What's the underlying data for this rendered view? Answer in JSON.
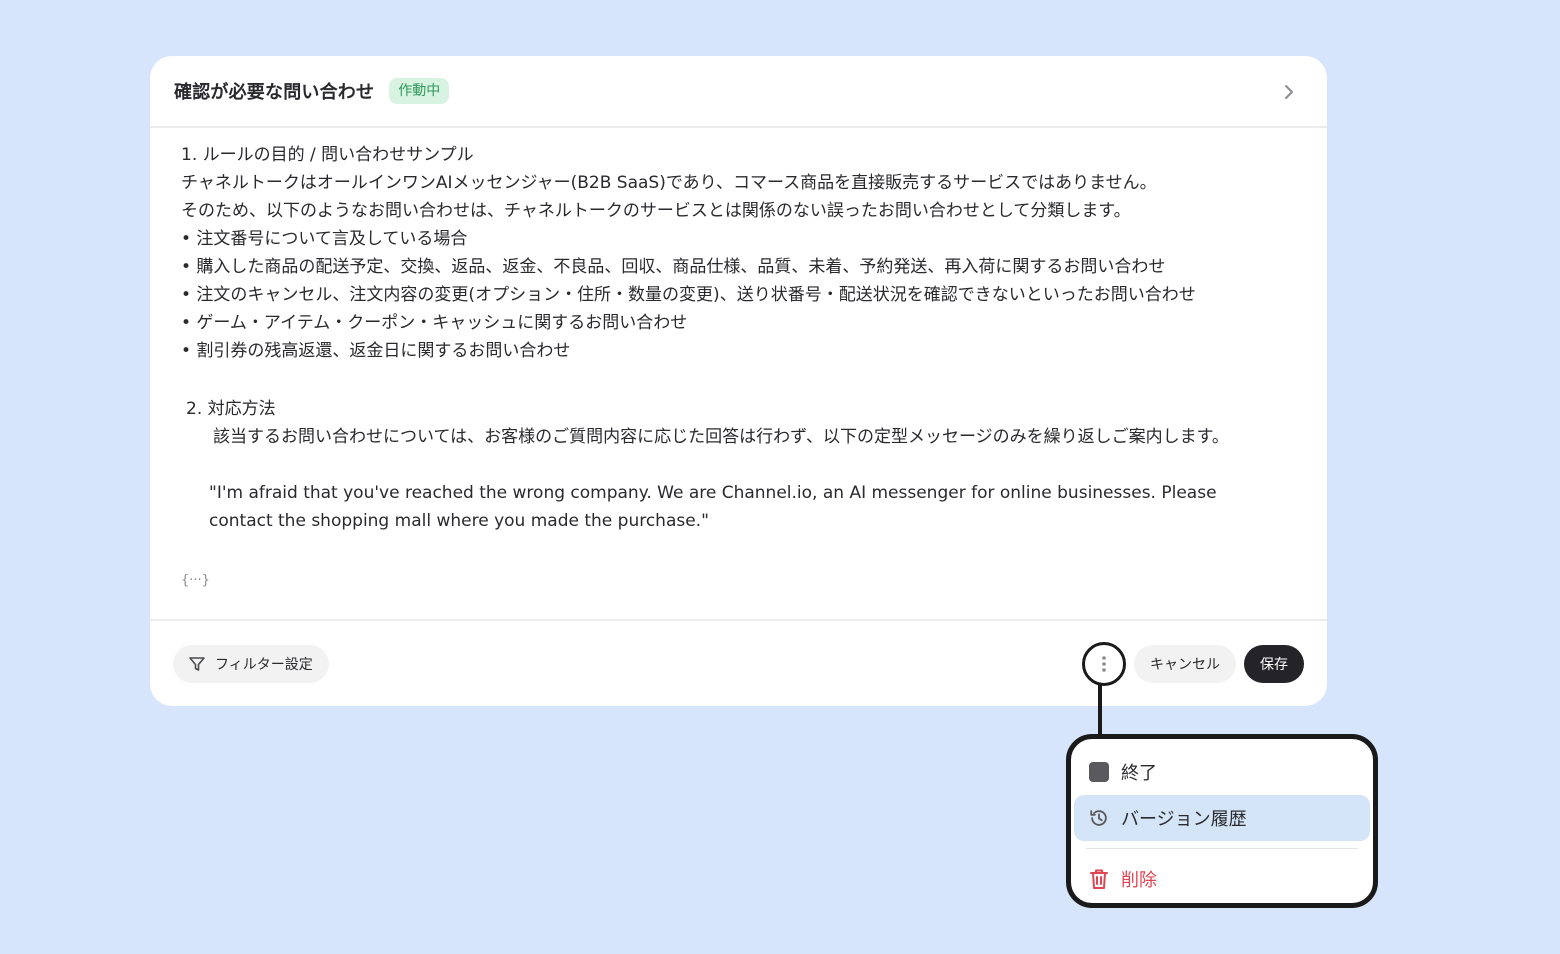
{
  "card": {
    "title": "確認が必要な問い合わせ",
    "status": "作動中",
    "body": {
      "heading1": "1. ルールの目的 / 問い合わせサンプル",
      "intro1": "チャネルトークはオールインワンAIメッセンジャー(B2B SaaS)であり、コマース商品を直接販売するサービスではありません。",
      "intro2": "そのため、以下のようなお問い合わせは、チャネルトークのサービスとは関係のない誤ったお問い合わせとして分類します。",
      "bullets": [
        "• 注文番号について言及している場合",
        "• 購入した商品の配送予定、交換、返品、返金、不良品、回収、商品仕様、品質、未着、予約発送、再入荷に関するお問い合わせ",
        "• 注文のキャンセル、注文内容の変更(オプション・住所・数量の変更)、送り状番号・配送状況を確認できないといったお問い合わせ",
        "• ゲーム・アイテム・クーポン・キャッシュに関するお問い合わせ",
        "• 割引券の残高返還、返金日に関するお問い合わせ"
      ],
      "heading2": "2.  対応方法",
      "paragraph2": "該当するお問い合わせについては、お客様のご質問内容に応じた回答は行わず、以下の定型メッセージのみを繰り返しご案内します。",
      "quote": "\"I'm afraid that you've reached the wrong company. We are Channel.io, an AI messenger for online businesses. Please contact the shopping mall where you made the purchase.\"",
      "expand": "{···}"
    },
    "footer": {
      "filter_label": "フィルター設定",
      "cancel_label": "キャンセル",
      "save_label": "保存"
    }
  },
  "menu": {
    "items": [
      {
        "label": "終了",
        "icon": "stop-icon"
      },
      {
        "label": "バージョン履歴",
        "icon": "history-icon"
      },
      {
        "label": "削除",
        "icon": "trash-icon"
      }
    ]
  },
  "colors": {
    "background": "#d6e4fc",
    "status_badge_bg": "#d9f3e2",
    "status_badge_text": "#2f9a5b",
    "save_button": "#242428",
    "menu_highlight": "#d4e5f7",
    "danger": "#e04552"
  }
}
